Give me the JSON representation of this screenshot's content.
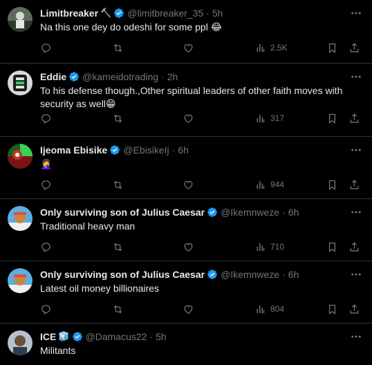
{
  "tweets": [
    {
      "name": "Limitbreaker",
      "name_emoji": "🔨",
      "handle": "@limitbreaker_35",
      "time": "5h",
      "text": "Na this one dey do odeshi for some ppl 😂",
      "views": "2.5K",
      "avatar_color": "#7a8c7a"
    },
    {
      "name": "Eddie",
      "name_emoji": "",
      "handle": "@kameidotrading",
      "time": "2h",
      "text": "To his defense though.,Other spiritual leaders of other faith moves with security as well😁",
      "views": "317",
      "avatar_color": "#3a3a3a"
    },
    {
      "name": "Ijeoma Ebisike",
      "name_emoji": "",
      "handle": "@EbisikeIj",
      "time": "6h",
      "text": "🤦‍♀️",
      "views": "944",
      "avatar_color": "#8b1d1d"
    },
    {
      "name": "Only surviving son of Julius Caesar",
      "name_emoji": "",
      "handle": "@Ikemnweze",
      "time": "6h",
      "text": "Traditional heavy man",
      "views": "710",
      "avatar_color": "#c0392b"
    },
    {
      "name": "Only surviving son of Julius Caesar",
      "name_emoji": "",
      "handle": "@Ikemnweze",
      "time": "6h",
      "text": "Latest oil money billionaires",
      "views": "804",
      "avatar_color": "#c0392b"
    },
    {
      "name": "ICE",
      "name_emoji": "🧊",
      "handle": "@Damacus22",
      "time": "5h",
      "text": "Militants",
      "views": "",
      "avatar_color": "#9aa5b1"
    }
  ],
  "colors": {
    "background": "#000000",
    "text": "#e7e9ea",
    "muted": "#71767b",
    "divider": "#2f3336",
    "verified": "#1d9bf0"
  },
  "icons": [
    "more-icon",
    "reply-icon",
    "retweet-icon",
    "like-icon",
    "views-icon",
    "bookmark-icon",
    "share-icon",
    "verified-badge-icon"
  ]
}
